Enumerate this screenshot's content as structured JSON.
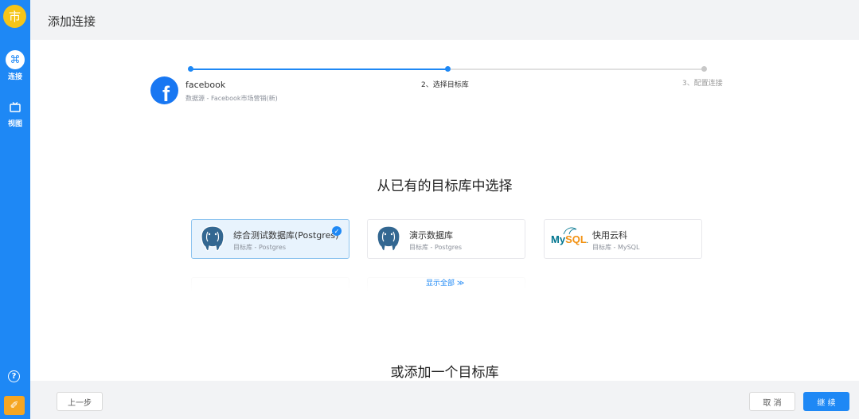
{
  "app": {
    "logo_char": "市"
  },
  "sidebar": {
    "items": [
      {
        "label": "连接",
        "icon": "command-icon",
        "active": true
      },
      {
        "label": "视图",
        "icon": "tv-icon",
        "active": false
      }
    ],
    "help_char": "?"
  },
  "header": {
    "title": "添加连接"
  },
  "steps": {
    "source_name": "facebook",
    "source_desc": "数据源 - Facebook市场营销(新)",
    "step2": "2、选择目标库",
    "step3": "3、配置连接"
  },
  "existing": {
    "title": "从已有的目标库中选择",
    "cards": [
      {
        "name": "综合测试数据库(Postgres)",
        "sub": "目标库 - Postgres",
        "type": "postgres",
        "selected": true
      },
      {
        "name": "演示数据库",
        "sub": "目标库 - Postgres",
        "type": "postgres",
        "selected": false
      },
      {
        "name": "快用云科",
        "sub": "目标库 - MySQL",
        "type": "mysql",
        "selected": false
      }
    ],
    "show_all": "显示全部 ≫"
  },
  "add_new": {
    "title": "或添加一个目标库"
  },
  "footer": {
    "prev": "上一步",
    "cancel": "取 消",
    "continue": "继 续"
  },
  "colors": {
    "primary": "#1e88f5",
    "logo": "#f5c518",
    "facebook": "#1877f2"
  }
}
